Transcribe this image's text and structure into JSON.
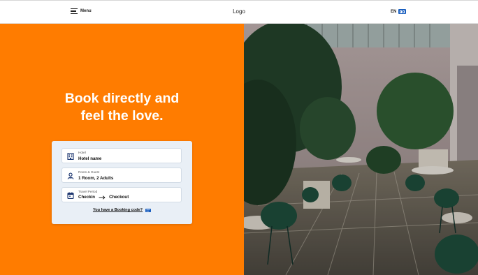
{
  "header": {
    "menu_label": "Menu",
    "logo_text": "Logo",
    "language": "EN"
  },
  "hero": {
    "headline_line1": "Book directly and",
    "headline_line2": "feel the love."
  },
  "booking_form": {
    "hotel": {
      "label": "Hotel",
      "value": "Hotel name",
      "icon": "building-icon"
    },
    "room_guest": {
      "label": "Room & Guest",
      "value": "1 Room, 2 Adults",
      "icon": "person-icon"
    },
    "travel_period": {
      "label": "Travel Period",
      "checkin": "Checkin",
      "checkout": "Checkout",
      "icon": "calendar-icon"
    },
    "booking_code_link": "You have a Booking code?"
  },
  "colors": {
    "accent_orange": "#ff7c00",
    "card_background": "#e9eff6",
    "flag_blue": "#1a5fbf",
    "icon_navy": "#16306b"
  },
  "photo": {
    "subject": "hotel-courtyard-photo"
  }
}
